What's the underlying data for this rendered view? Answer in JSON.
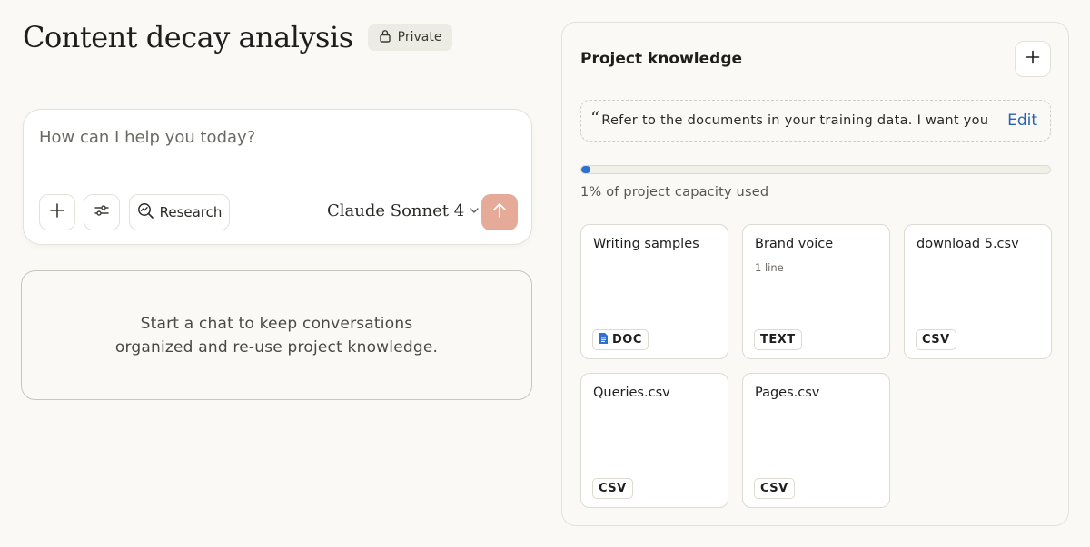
{
  "header": {
    "title": "Content decay analysis",
    "visibility_label": "Private",
    "visibility_icon": "lock-icon"
  },
  "composer": {
    "placeholder": "How can I help you today?",
    "research_label": "Research",
    "model_label": "Claude Sonnet 4",
    "send_color": "#e6aa99"
  },
  "empty_state": {
    "line1": "Start a chat to keep conversations",
    "line2": "organized and re-use project knowledge."
  },
  "knowledge": {
    "title": "Project knowledge",
    "instructions_quote": "“",
    "instructions_preview": "Refer to the documents in your training data. I want you",
    "edit_label": "Edit",
    "capacity_fraction": 0.01,
    "capacity_text": "1% of project capacity used",
    "files": [
      {
        "name": "Writing samples",
        "sub": "",
        "type": "DOC",
        "icon": "document-icon"
      },
      {
        "name": "Brand voice",
        "sub": "1 line",
        "type": "TEXT",
        "icon": ""
      },
      {
        "name": "download 5.csv",
        "sub": "",
        "type": "CSV",
        "icon": ""
      },
      {
        "name": "Queries.csv",
        "sub": "",
        "type": "CSV",
        "icon": ""
      },
      {
        "name": "Pages.csv",
        "sub": "",
        "type": "CSV",
        "icon": ""
      }
    ]
  },
  "colors": {
    "accent_blue": "#2f6fd0",
    "link_blue": "#2a62b8",
    "background": "#faf9f5"
  }
}
